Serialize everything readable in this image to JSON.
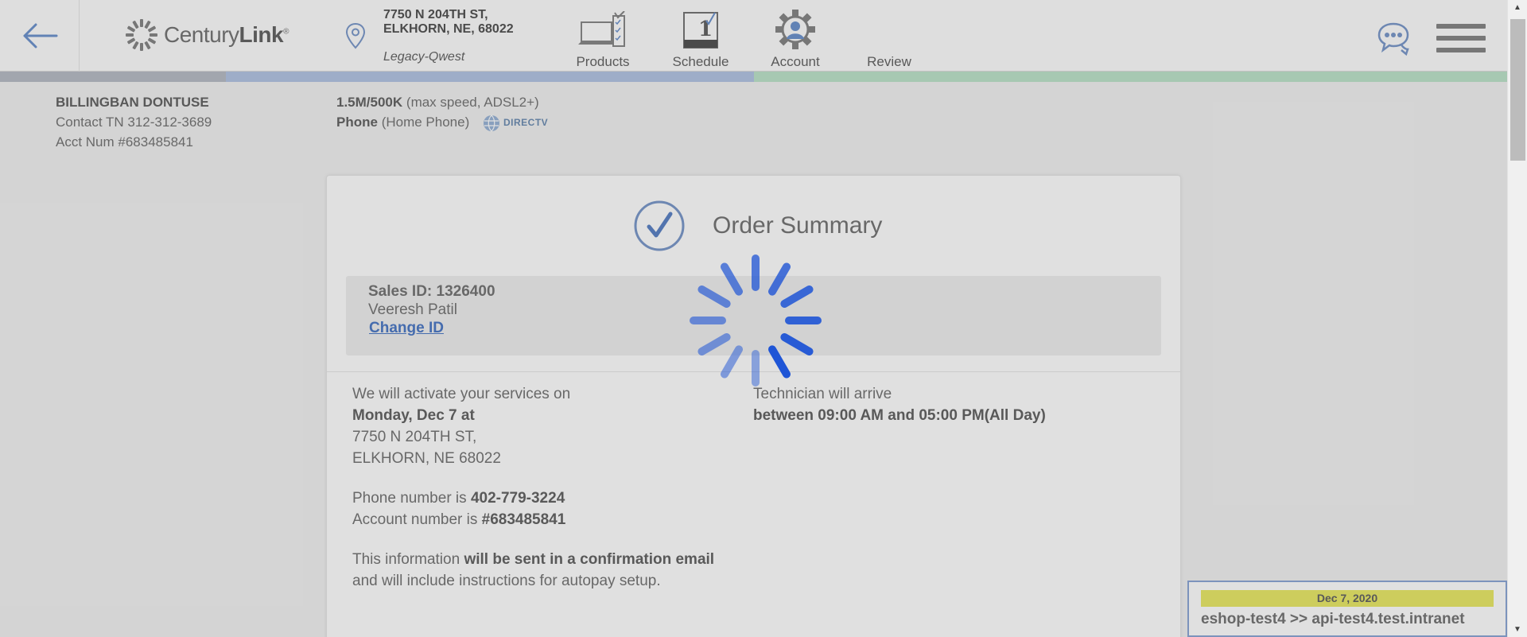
{
  "header": {
    "back_icon": "arrow-left-icon",
    "logo_prefix": "Century",
    "logo_suffix": "Link",
    "logo_mark": "®",
    "address_line1": "7750 N 204TH ST,",
    "address_line2": "ELKHORN, NE, 68022",
    "legacy": "Legacy-Qwest",
    "nav": [
      {
        "label": "Products",
        "icon": "laptop-checklist-icon"
      },
      {
        "label": "Schedule",
        "icon": "calendar-icon",
        "calendar_day": "1"
      },
      {
        "label": "Account",
        "icon": "account-gear-icon"
      },
      {
        "label": "Review",
        "icon": ""
      }
    ],
    "chat_icon": "chat-bubbles-icon",
    "menu_icon": "hamburger-menu-icon"
  },
  "progress_colors": [
    "#b9bdc7",
    "#b4c5e4",
    "#bfe4cb"
  ],
  "customer": {
    "name": "BILLINGBAN DONTUSE",
    "contact": "Contact TN 312-312-3689",
    "account": "Acct Num #683485841"
  },
  "services": {
    "speed": "1.5M/500K",
    "speed_detail": "(max speed, ADSL2+)",
    "phone": "Phone",
    "phone_detail": "(Home Phone)",
    "directv": "DIRECTV"
  },
  "summary": {
    "title": "Order Summary",
    "sales_id": "Sales ID: 1326400",
    "agent": "Veeresh Patil",
    "change_id": "Change ID",
    "activate_intro": "We will activate your services on",
    "activate_date": "Monday, Dec 7 at",
    "service_addr1": "7750 N 204TH ST,",
    "service_addr2": "ELKHORN, NE 68022",
    "phone_prefix": "Phone number is",
    "phone_number": "402-779-3224",
    "account_prefix": "Account number is",
    "account_number": "#683485841",
    "info_prefix": "This information",
    "info_bold": "will be sent in a confirmation email",
    "info_suffix": "and will include instructions for autopay setup.",
    "tech_intro": "Technician will arrive",
    "tech_window": "between 09:00 AM and 05:00 PM(All Day)"
  },
  "environment": {
    "date": "Dec 7, 2020",
    "host": "eshop-test4 >> api-test4.test.intranet"
  },
  "colors": {
    "accent": "#4f7bc7",
    "spinner": "#1f55d6"
  }
}
